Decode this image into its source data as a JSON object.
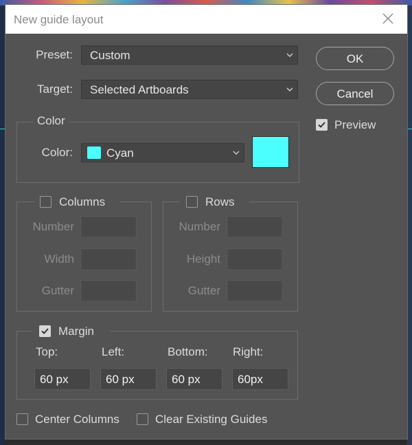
{
  "dialog": {
    "title": "New guide layout",
    "buttons": {
      "ok": "OK",
      "cancel": "Cancel"
    },
    "preview": {
      "label": "Preview",
      "checked": true
    }
  },
  "preset": {
    "label": "Preset:",
    "value": "Custom"
  },
  "target": {
    "label": "Target:",
    "value": "Selected Artboards"
  },
  "color_group": {
    "title": "Color",
    "label": "Color:",
    "value": "Cyan",
    "swatch_color": "#4bffff"
  },
  "columns": {
    "title": "Columns",
    "checked": false,
    "fields": [
      {
        "label": "Number",
        "value": ""
      },
      {
        "label": "Width",
        "value": ""
      },
      {
        "label": "Gutter",
        "value": ""
      }
    ]
  },
  "rows": {
    "title": "Rows",
    "checked": false,
    "fields": [
      {
        "label": "Number",
        "value": ""
      },
      {
        "label": "Height",
        "value": ""
      },
      {
        "label": "Gutter",
        "value": ""
      }
    ]
  },
  "margin": {
    "title": "Margin",
    "checked": true,
    "fields": [
      {
        "label": "Top:",
        "value": "60 px"
      },
      {
        "label": "Left:",
        "value": "60 px"
      },
      {
        "label": "Bottom:",
        "value": "60 px"
      },
      {
        "label": "Right:",
        "value": "60px"
      }
    ]
  },
  "options": {
    "center_columns": {
      "label": "Center Columns",
      "checked": false
    },
    "clear_existing_guides": {
      "label": "Clear Existing Guides",
      "checked": false
    }
  },
  "icons": {
    "close": "close-icon",
    "chevron": "chevron-down-icon",
    "check": "checkmark-icon"
  },
  "colors": {
    "dialog_bg": "#535353",
    "guide_cyan": "#4bffff"
  }
}
